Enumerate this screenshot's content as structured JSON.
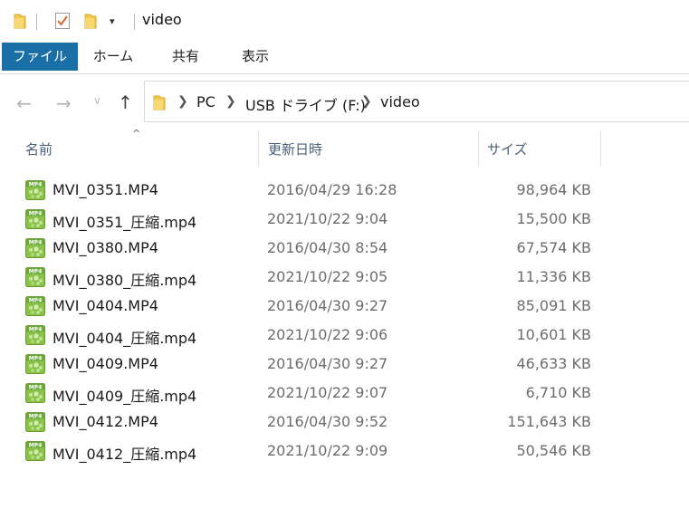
{
  "window": {
    "title": "video"
  },
  "quick_access": {
    "folder_icon": "folder-icon",
    "properties_icon": "properties-check-icon",
    "new_folder_icon": "new-folder-icon",
    "dropdown_glyph": "▾"
  },
  "ribbon": {
    "tabs": [
      {
        "label": "ファイル",
        "active": true
      },
      {
        "label": "ホーム"
      },
      {
        "label": "共有"
      },
      {
        "label": "表示"
      }
    ]
  },
  "nav": {
    "back": "←",
    "forward": "→",
    "recent": "∨",
    "up": "↑"
  },
  "address": {
    "crumbs": [
      "PC",
      "USB ドライブ (F:)",
      "video"
    ]
  },
  "columns": {
    "name": "名前",
    "modified": "更新日時",
    "size": "サイズ",
    "sort_indicator": "^"
  },
  "files": [
    {
      "name": "MVI_0351.MP4",
      "modified": "2016/04/29 16:28",
      "size": "98,964 KB",
      "icon_label": "MP4"
    },
    {
      "name": "MVI_0351_圧縮.mp4",
      "modified": "2021/10/22 9:04",
      "size": "15,500 KB",
      "icon_label": "MP4"
    },
    {
      "name": "MVI_0380.MP4",
      "modified": "2016/04/30 8:54",
      "size": "67,574 KB",
      "icon_label": "MP4"
    },
    {
      "name": "MVI_0380_圧縮.mp4",
      "modified": "2021/10/22 9:05",
      "size": "11,336 KB",
      "icon_label": "MP4"
    },
    {
      "name": "MVI_0404.MP4",
      "modified": "2016/04/30 9:27",
      "size": "85,091 KB",
      "icon_label": "MP4"
    },
    {
      "name": "MVI_0404_圧縮.mp4",
      "modified": "2021/10/22 9:06",
      "size": "10,601 KB",
      "icon_label": "MP4"
    },
    {
      "name": "MVI_0409.MP4",
      "modified": "2016/04/30 9:27",
      "size": "46,633 KB",
      "icon_label": "MP4"
    },
    {
      "name": "MVI_0409_圧縮.mp4",
      "modified": "2021/10/22 9:07",
      "size": "6,710 KB",
      "icon_label": "MP4"
    },
    {
      "name": "MVI_0412.MP4",
      "modified": "2016/04/30 9:52",
      "size": "151,643 KB",
      "icon_label": "MP4"
    },
    {
      "name": "MVI_0412_圧縮.mp4",
      "modified": "2021/10/22 9:09",
      "size": "50,546 KB",
      "icon_label": "MP4"
    }
  ],
  "colors": {
    "file_tab": "#1a6fa7",
    "folder": "#f2c94c",
    "mp4_icon": "#8bc34a",
    "header_text": "#4c607a"
  }
}
